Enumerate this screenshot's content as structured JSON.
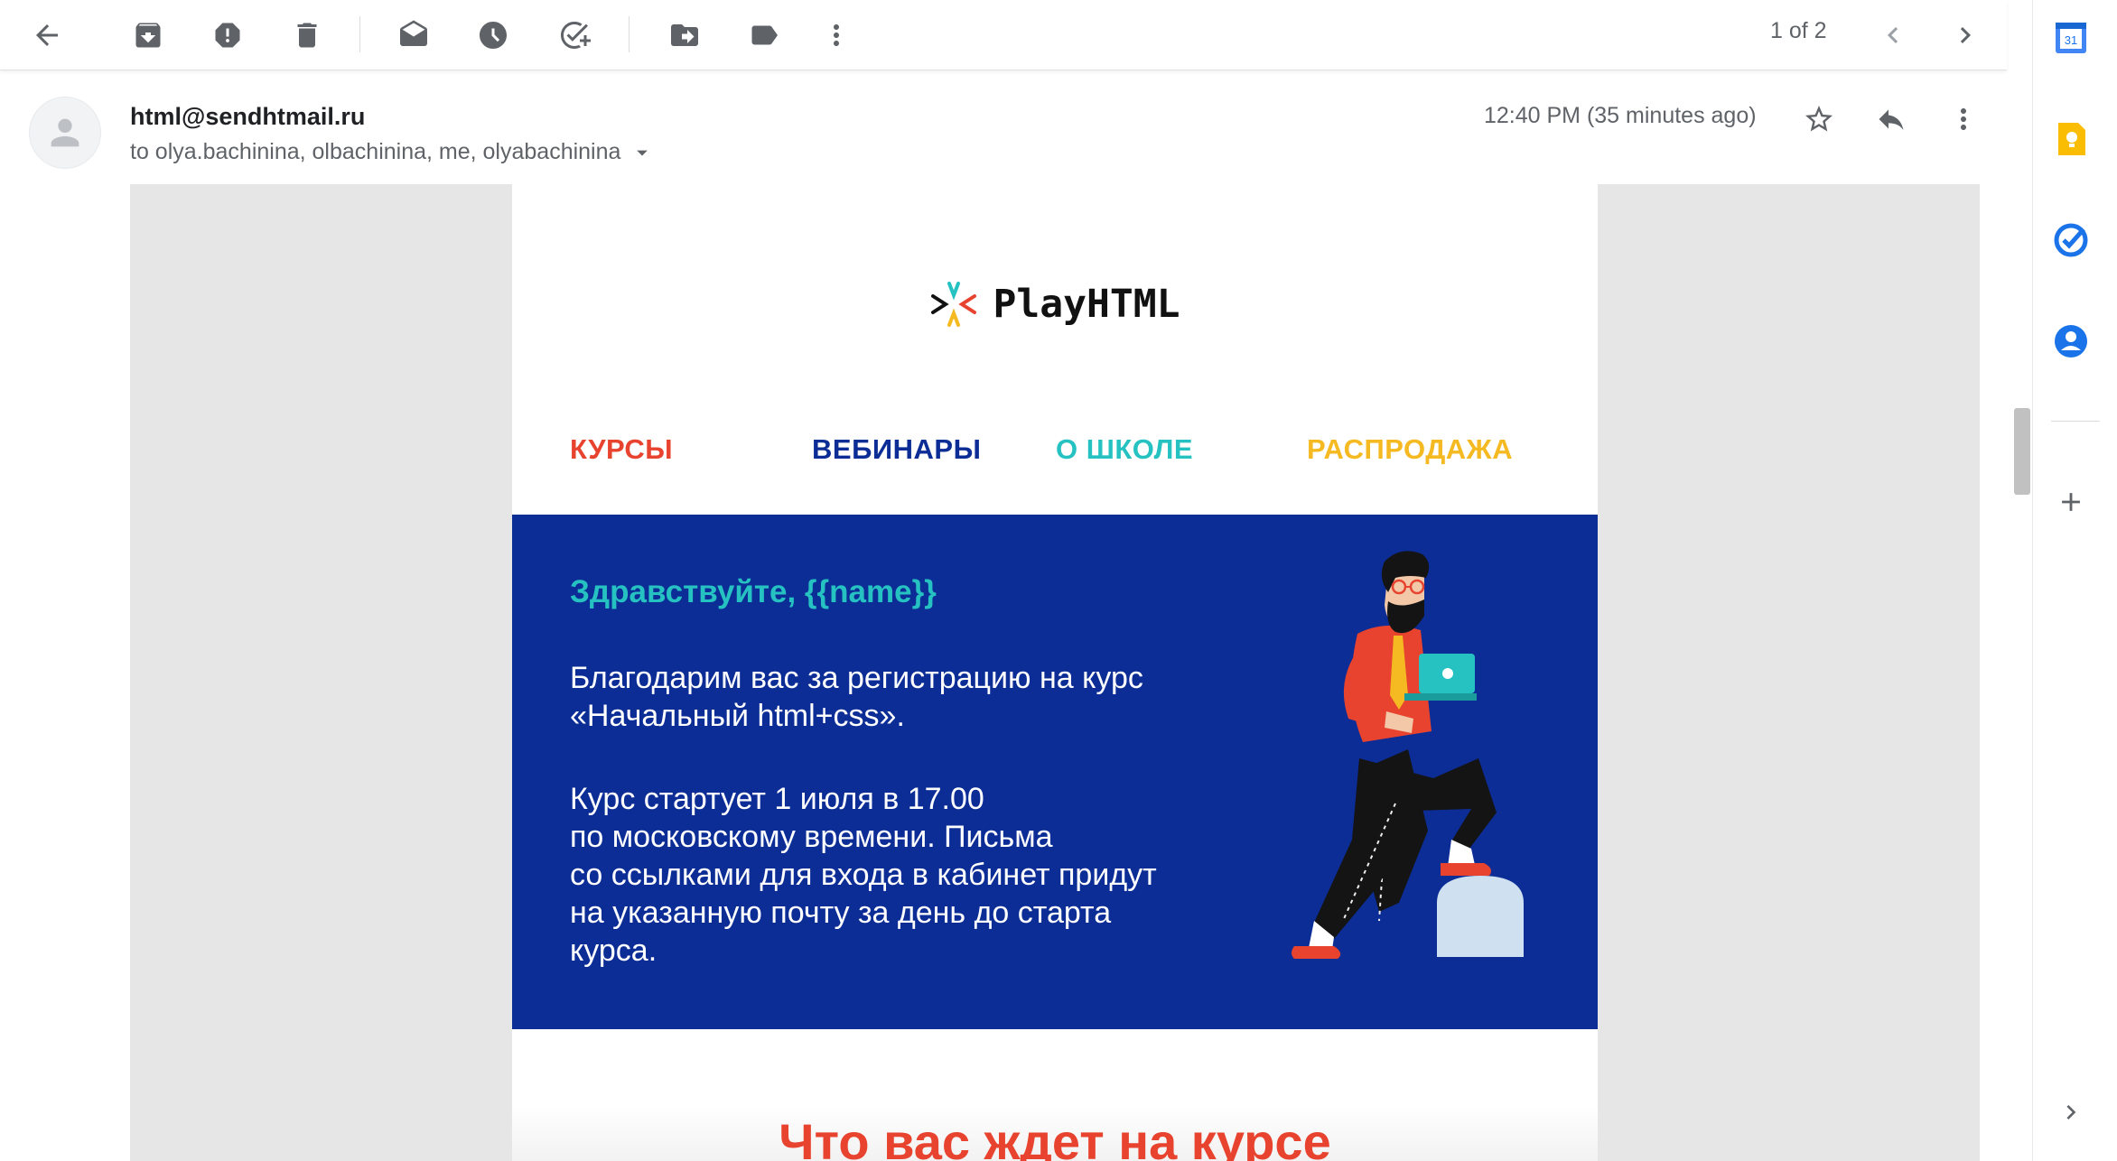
{
  "toolbar": {
    "icons": [
      "back-arrow-icon",
      "archive-icon",
      "report-spam-icon",
      "delete-icon",
      "mark-unread-icon",
      "snooze-icon",
      "add-to-tasks-icon",
      "move-to-icon",
      "label-icon",
      "more-vert-icon"
    ],
    "pager": "1 of 2"
  },
  "header": {
    "sender": "html@sendhtmail.ru",
    "recipients": "to olya.bachinina, olbachinina, me, olyabachinina",
    "time": "12:40 PM (35 minutes ago)"
  },
  "email": {
    "logo_text": "PlayHTML",
    "nav": [
      {
        "label": "КУРСЫ",
        "color": "#e8432f"
      },
      {
        "label": "ВЕБИНАРЫ",
        "color": "#0c2d95"
      },
      {
        "label": "О ШКОЛЕ",
        "color": "#26c2c2"
      },
      {
        "label": "РАСПРОДАЖА",
        "color": "#f5b921"
      }
    ],
    "hero": {
      "greeting": "Здравствуйте, {{name}}",
      "p1_lines": [
        "Благодарим вас за регистрацию на курс",
        "«Начальный html+css»."
      ],
      "p2_lines": [
        "Курс стартует 1 июля в 17.00",
        "по московскому времени. Письма",
        "со ссылками для входа в кабинет придут",
        "на указанную почту за день до старта",
        "курса."
      ],
      "bg": "#0c2d95"
    },
    "section_title": "Что вас ждет на курсе"
  },
  "side_panel": {
    "icons": [
      "calendar-icon",
      "keep-icon",
      "tasks-icon",
      "contacts-icon",
      "add-icon",
      "expand-icon"
    ],
    "calendar_day": "31"
  }
}
